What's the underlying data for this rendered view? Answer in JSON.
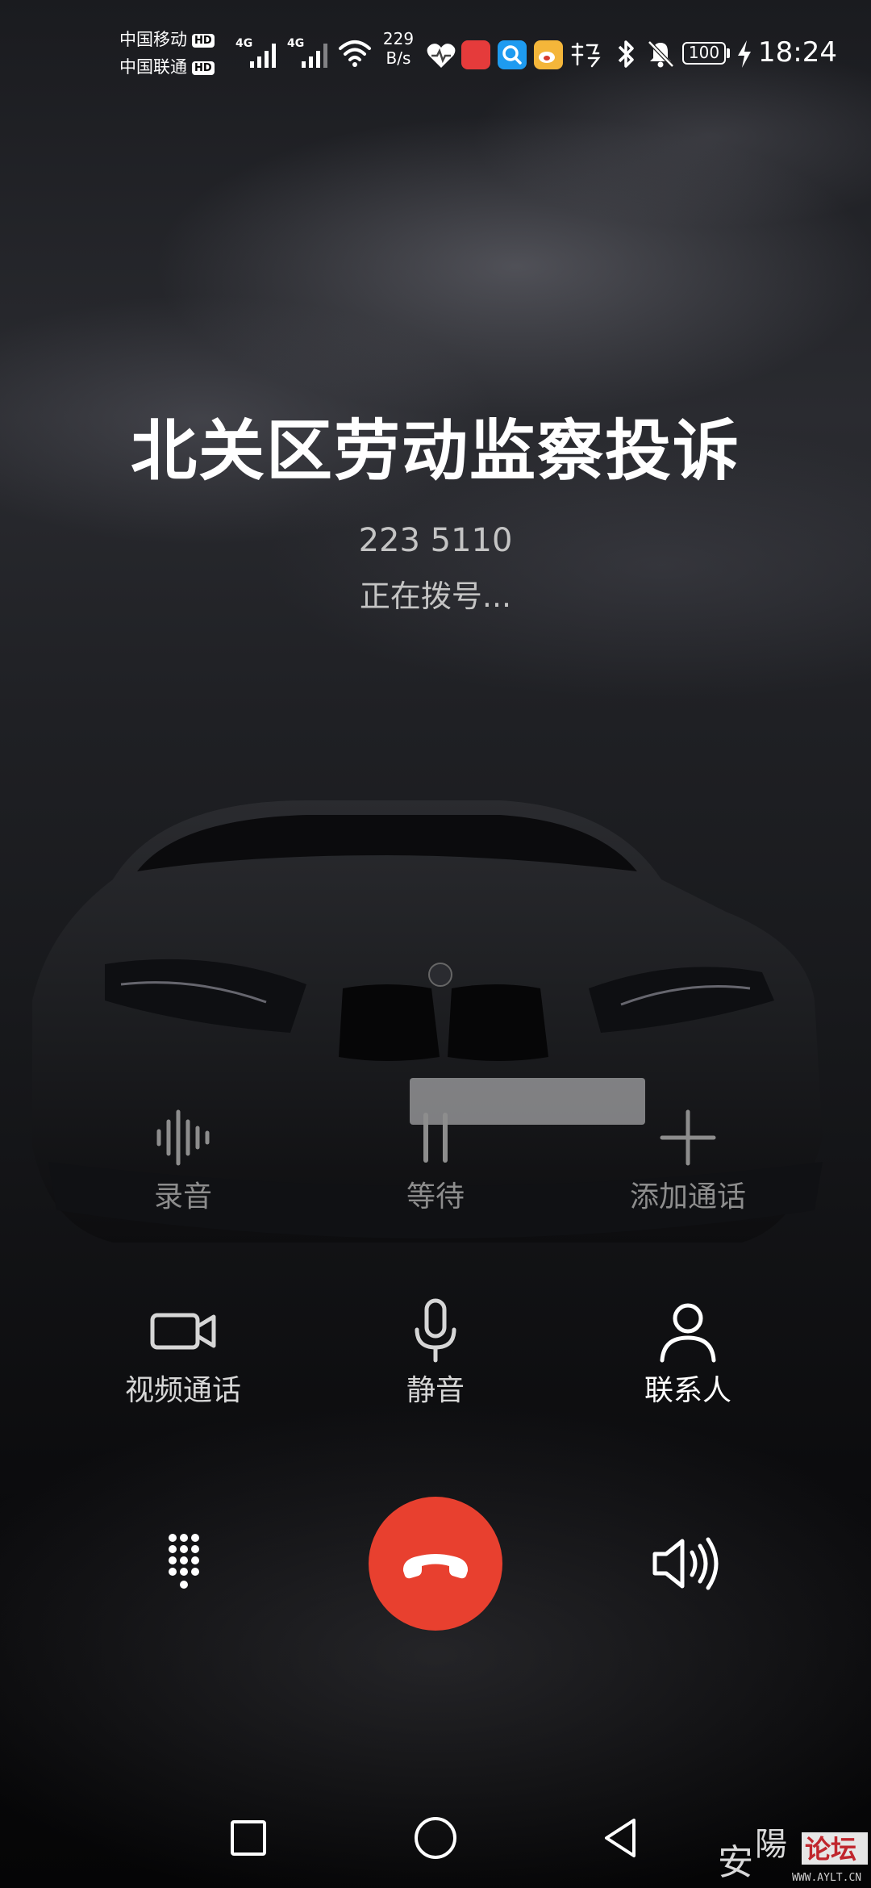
{
  "status_bar": {
    "carrier1": "中国移动",
    "carrier2": "中国联通",
    "hd_badge": "HD",
    "network1": "4G",
    "network2": "4G",
    "speed_value": "229",
    "speed_unit": "B/s",
    "battery": "100",
    "time": "18:24",
    "icons": [
      "heart-health-icon",
      "huawei-store-icon",
      "search-app-icon",
      "weibo-icon",
      "xuexi-app-icon",
      "bluetooth-icon",
      "do-not-disturb-bell-icon",
      "charging-bolt-icon"
    ]
  },
  "call": {
    "name": "北关区劳动监察投诉",
    "number": "223 5110",
    "status": "正在拨号..."
  },
  "actions": {
    "record": "录音",
    "hold": "等待",
    "add_call": "添加通话",
    "video_call": "视频通话",
    "mute": "静音",
    "contacts": "联系人"
  },
  "controls": {
    "dialpad": "dialpad-icon",
    "end_call": "end-call-icon",
    "speaker": "speaker-icon"
  },
  "watermark": {
    "text": "安陽论坛",
    "url": "WWW.AYLT.CN"
  },
  "colors": {
    "end_call": "#e8402f",
    "text_primary": "#ffffff",
    "text_secondary": "#c4c4c4",
    "text_disabled": "#8d8d8d"
  }
}
